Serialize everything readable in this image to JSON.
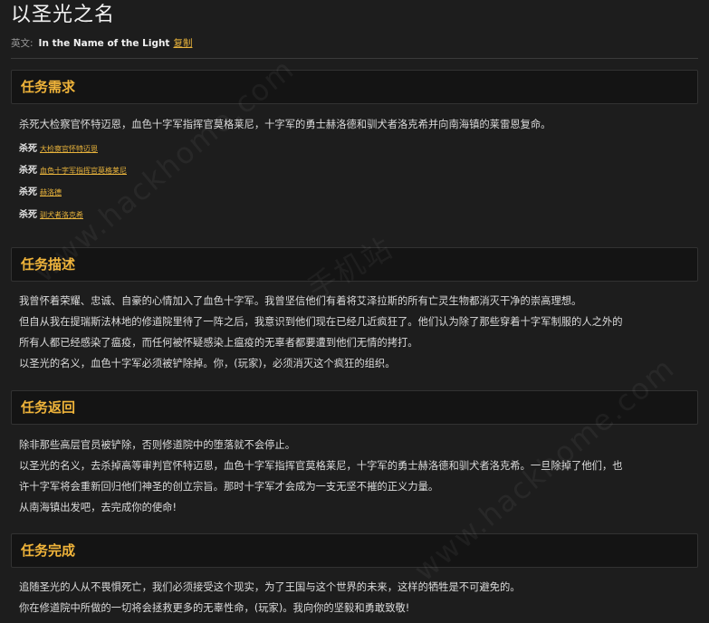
{
  "page": {
    "title": "以圣光之名",
    "english_label": "英文:",
    "english_name": "In the Name of the Light",
    "copy_label": "复制"
  },
  "requirements": {
    "heading": "任务需求",
    "summary": "杀死大检察官怀特迈恩，血色十字军指挥官莫格莱尼，十字军的勇士赫洛德和驯犬者洛克希并向南海镇的莱雷恩复命。",
    "kill_label": "杀死",
    "targets": [
      "大检察官怀特迈恩",
      "血色十字军指挥官莫格莱尼",
      "赫洛德",
      "驯犬者洛克希"
    ]
  },
  "description": {
    "heading": "任务描述",
    "lines": [
      "我曾怀着荣耀、忠诚、自豪的心情加入了血色十字军。我曾坚信他们有着将艾泽拉斯的所有亡灵生物都消灭干净的崇高理想。",
      "但自从我在提瑞斯法林地的修道院里待了一阵之后，我意识到他们现在已经几近疯狂了。他们认为除了那些穿着十字军制服的人之外的",
      "所有人都已经感染了瘟疫，而任何被怀疑感染上瘟疫的无辜者都要遭到他们无情的拷打。",
      "以圣光的名义，血色十字军必须被铲除掉。你，(玩家)，必须消灭这个疯狂的组织。"
    ]
  },
  "return": {
    "heading": "任务返回",
    "lines": [
      "除非那些高层官员被铲除，否则修道院中的堕落就不会停止。",
      "以圣光的名义，去杀掉高等审判官怀特迈恩，血色十字军指挥官莫格莱尼，十字军的勇士赫洛德和驯犬者洛克希。一旦除掉了他们，也",
      "许十字军将会重新回归他们神圣的创立宗旨。那时十字军才会成为一支无坚不摧的正义力量。",
      "从南海镇出发吧，去完成你的使命!"
    ]
  },
  "completion": {
    "heading": "任务完成",
    "lines": [
      "追随圣光的人从不畏惧死亡，我们必须接受这个现实，为了王国与这个世界的未来，这样的牺牲是不可避免的。",
      "你在修道院中所做的一切将会拯救更多的无辜性命，(玩家)。我向你的坚毅和勇敢致敬!"
    ]
  },
  "watermarks": [
    "www.hackhome.com",
    "手机站",
    "www.hackhome.com"
  ],
  "colors": {
    "accent": "#f0b43a",
    "link": "#e8b33c",
    "background": "#1d1d1d",
    "header_bg": "#141414"
  }
}
